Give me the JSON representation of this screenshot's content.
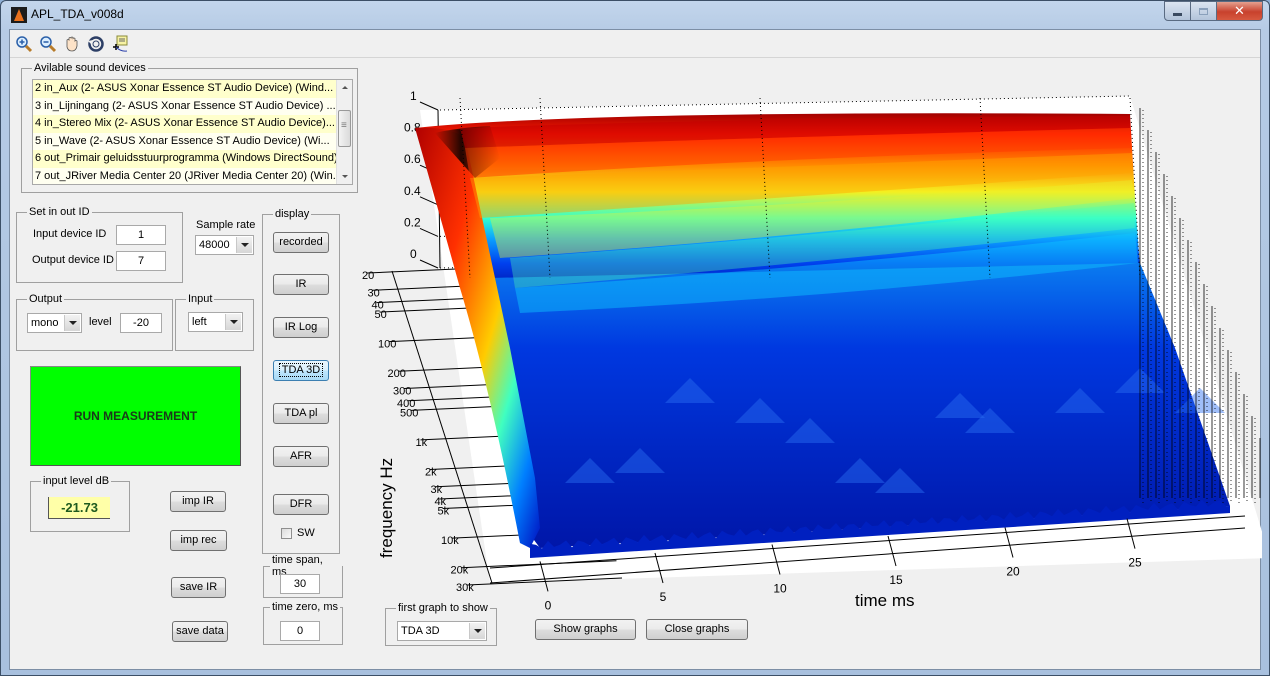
{
  "window": {
    "title": "APL_TDA_v008d",
    "controls": {
      "minimize": "–",
      "maximize": "□",
      "close": "x"
    }
  },
  "toolbar": {
    "items": [
      {
        "name": "zoom-in-icon",
        "tooltip": "Zoom In"
      },
      {
        "name": "zoom-out-icon",
        "tooltip": "Zoom Out"
      },
      {
        "name": "pan-hand-icon",
        "tooltip": "Pan"
      },
      {
        "name": "rotate-3d-icon",
        "tooltip": "Rotate 3D"
      },
      {
        "name": "data-cursor-icon",
        "tooltip": "Data Cursor"
      }
    ]
  },
  "devices": {
    "legend": "Avilable sound devices",
    "items": [
      "2 in_Aux (2- ASUS Xonar Essence ST Audio Device) (Wind...",
      "3 in_Lijningang (2- ASUS Xonar Essence ST Audio Device) ...",
      "4 in_Stereo Mix (2- ASUS Xonar Essence ST Audio Device)...",
      "5 in_Wave (2- ASUS Xonar Essence ST Audio Device) (Wi...",
      "6 out_Primair geluidsstuurprogramma (Windows DirectSound)",
      "7 out_JRiver Media Center 20 (JRiver Media Center 20) (Win..."
    ]
  },
  "set_io": {
    "legend": "Set in out ID",
    "input_label": "Input device ID",
    "input_value": "1",
    "output_label": "Output device ID",
    "output_value": "7"
  },
  "sample_rate": {
    "label": "Sample rate",
    "value": "48000"
  },
  "output": {
    "legend": "Output",
    "mode": "mono",
    "level_label": "level",
    "level_value": "-20"
  },
  "input": {
    "legend": "Input",
    "channel": "left"
  },
  "run_button": {
    "label": "RUN MEASUREMENT",
    "color": "#00ff00"
  },
  "input_level": {
    "legend": "input level dB",
    "value": "-21.73"
  },
  "file_buttons": {
    "imp_ir": "imp IR",
    "imp_rec": "imp rec",
    "save_ir": "save IR",
    "save_data": "save data"
  },
  "display": {
    "legend": "display",
    "buttons": [
      "recorded",
      "IR",
      "IR Log",
      "TDA 3D",
      "TDA pl",
      "AFR",
      "DFR"
    ],
    "active": "TDA 3D",
    "sw_label": "SW",
    "sw_checked": false
  },
  "time_span": {
    "legend": "time span, ms",
    "value": "30"
  },
  "time_zero": {
    "legend": "time zero, ms",
    "value": "0"
  },
  "first_graph": {
    "legend": "first graph to show",
    "value": "TDA 3D"
  },
  "graph_buttons": {
    "show": "Show graphs",
    "close": "Close graphs"
  },
  "chart_data": {
    "type": "surface-3d",
    "title": "",
    "xlabel": "time   ms",
    "ylabel": "frequency   Hz",
    "zlabel": "",
    "x_ticks": [
      "0",
      "5",
      "10",
      "15",
      "20",
      "25"
    ],
    "x_range": [
      0,
      30
    ],
    "y_ticks": [
      "20",
      "30",
      "40",
      "50",
      "100",
      "200",
      "300",
      "400",
      "500",
      "1k",
      "2k",
      "3k",
      "4k",
      "5k",
      "10k",
      "20k",
      "30k"
    ],
    "y_range": [
      20,
      30000
    ],
    "y_scale": "log",
    "z_ticks": [
      "0",
      "0.2",
      "0.4",
      "0.6",
      "0.8",
      "1"
    ],
    "z_range": [
      0,
      1
    ],
    "colormap": "jet",
    "grid": true
  }
}
